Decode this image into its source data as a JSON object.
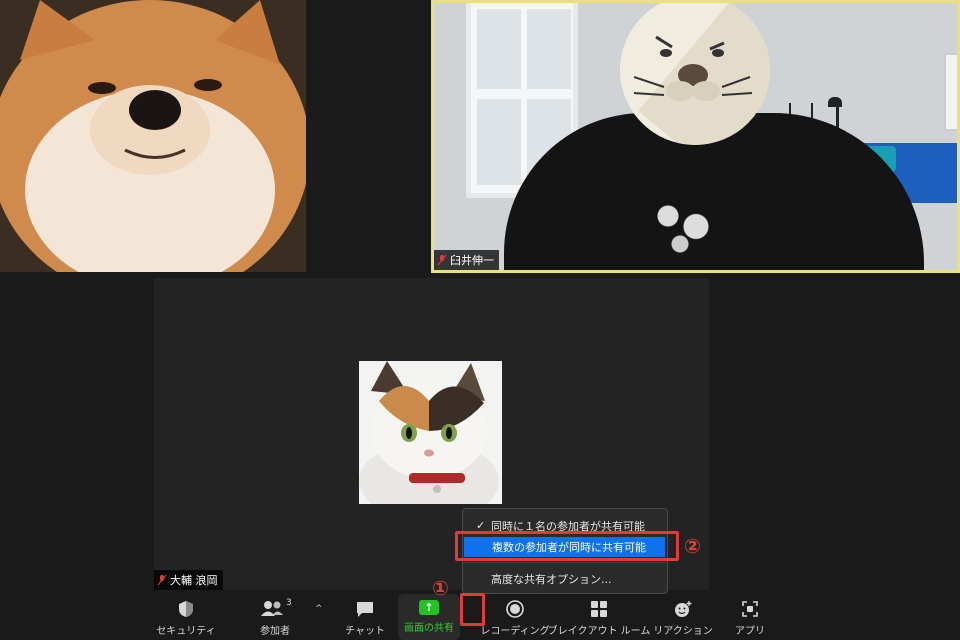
{
  "participants": {
    "top_right_name": "臼井伸一",
    "main_name": "大輔 浪岡"
  },
  "share_menu": {
    "items": [
      {
        "label": "同時に１名の参加者が共有可能",
        "checked": true
      },
      {
        "label": "複数の参加者が同時に共有可能",
        "highlighted": true
      },
      {
        "label": "高度な共有オプション..."
      }
    ],
    "check_glyph": "✓"
  },
  "callouts": {
    "one": "①",
    "two": "②"
  },
  "toolbar": {
    "security": "セキュリティ",
    "participants": "参加者",
    "participants_count": "3",
    "chat": "チャット",
    "share_screen": "画面の共有",
    "recording": "レコーディング",
    "breakout": "ブレイクアウト ルーム",
    "reactions": "リアクション",
    "apps": "アプリ",
    "caret_glyph": "^",
    "share_arrow_glyph": "↑"
  },
  "colors": {
    "accent_green": "#24c324",
    "highlight_blue": "#0e72ed",
    "callout_red": "#e03a3a",
    "active_speaker_border": "#e8e27a"
  }
}
